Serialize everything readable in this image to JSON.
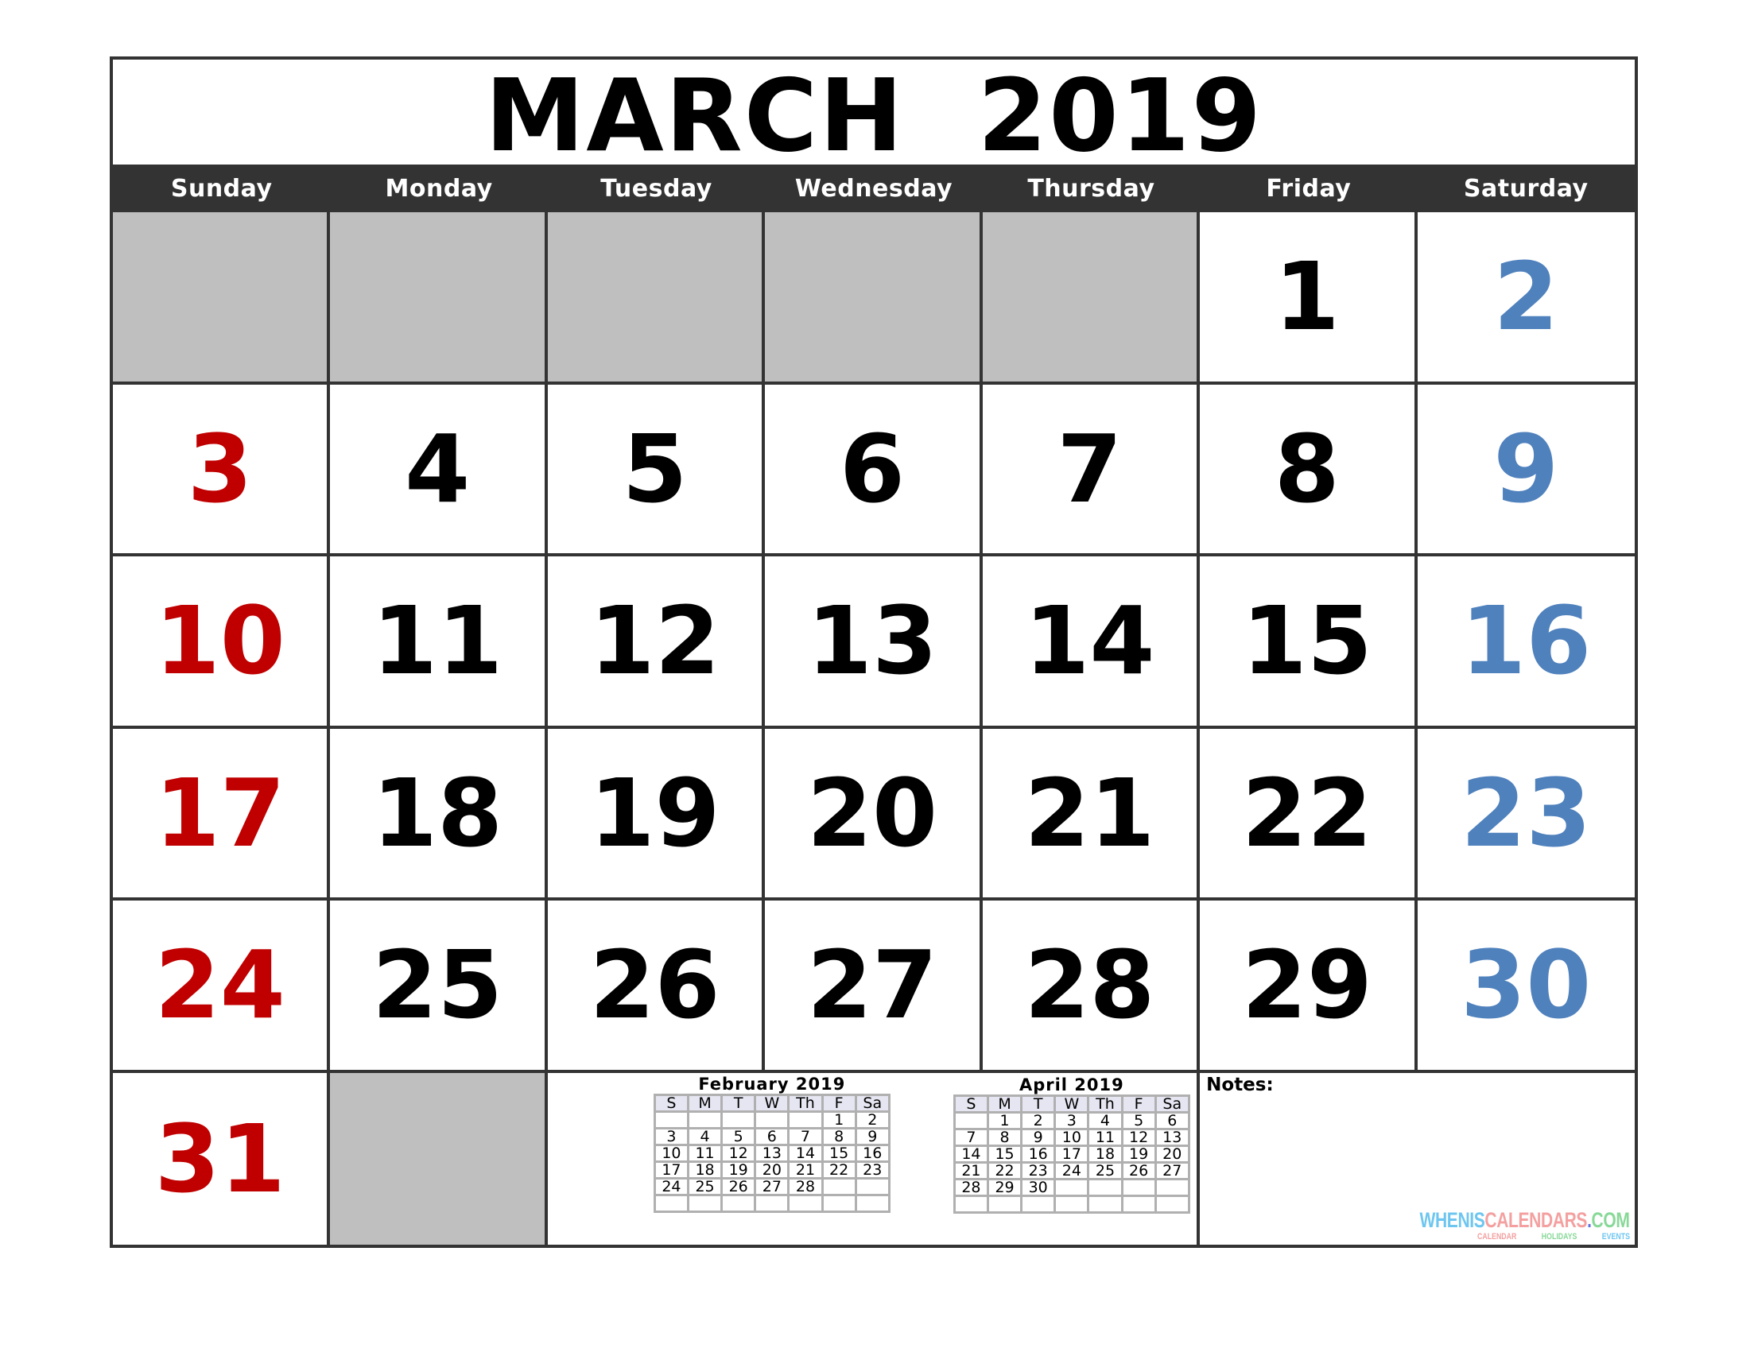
{
  "calendar": {
    "title": "MARCH  2019",
    "weekdays": [
      "Sunday",
      "Monday",
      "Tuesday",
      "Wednesday",
      "Thursday",
      "Friday",
      "Saturday"
    ],
    "weeks": [
      [
        "",
        "",
        "",
        "",
        "",
        "1",
        "2"
      ],
      [
        "3",
        "4",
        "5",
        "6",
        "7",
        "8",
        "9"
      ],
      [
        "10",
        "11",
        "12",
        "13",
        "14",
        "15",
        "16"
      ],
      [
        "17",
        "18",
        "19",
        "20",
        "21",
        "22",
        "23"
      ],
      [
        "24",
        "25",
        "26",
        "27",
        "28",
        "29",
        "30"
      ],
      [
        "31",
        "",
        null,
        null,
        null,
        null,
        null
      ]
    ],
    "colors": {
      "sunday": "#C00000",
      "saturday": "#4F81BD",
      "weekday": "#000000",
      "header_band": "#333333",
      "empty_cell": "#BFBFBF"
    }
  },
  "mini_calendars": [
    {
      "title": "February 2019",
      "weekdays": [
        "S",
        "M",
        "T",
        "W",
        "Th",
        "F",
        "Sa"
      ],
      "weeks": [
        [
          "",
          "",
          "",
          "",
          "",
          "1",
          "2"
        ],
        [
          "3",
          "4",
          "5",
          "6",
          "7",
          "8",
          "9"
        ],
        [
          "10",
          "11",
          "12",
          "13",
          "14",
          "15",
          "16"
        ],
        [
          "17",
          "18",
          "19",
          "20",
          "21",
          "22",
          "23"
        ],
        [
          "24",
          "25",
          "26",
          "27",
          "28",
          "",
          ""
        ],
        [
          "",
          "",
          "",
          "",
          "",
          "",
          ""
        ]
      ]
    },
    {
      "title": "April 2019",
      "weekdays": [
        "S",
        "M",
        "T",
        "W",
        "Th",
        "F",
        "Sa"
      ],
      "weeks": [
        [
          "",
          "1",
          "2",
          "3",
          "4",
          "5",
          "6"
        ],
        [
          "7",
          "8",
          "9",
          "10",
          "11",
          "12",
          "13"
        ],
        [
          "14",
          "15",
          "16",
          "17",
          "18",
          "19",
          "20"
        ],
        [
          "21",
          "22",
          "23",
          "24",
          "25",
          "26",
          "27"
        ],
        [
          "28",
          "29",
          "30",
          "",
          "",
          "",
          ""
        ],
        [
          "",
          "",
          "",
          "",
          "",
          "",
          ""
        ]
      ]
    }
  ],
  "notes": {
    "label": "Notes:"
  },
  "logo": {
    "parts": [
      {
        "text": "WHENIS",
        "color": "#6EC6F0"
      },
      {
        "text": "CALENDARS",
        "color": "#F4A0A0"
      },
      {
        "text": ".",
        "color": "#6070E0"
      },
      {
        "text": "COM",
        "color": "#88D898"
      }
    ],
    "sub": [
      {
        "text": "CALENDAR",
        "color": "#F4A0A0"
      },
      {
        "text": "HOLIDAYS",
        "color": "#88D898"
      },
      {
        "text": "EVENTS",
        "color": "#6EC6F0"
      }
    ]
  }
}
